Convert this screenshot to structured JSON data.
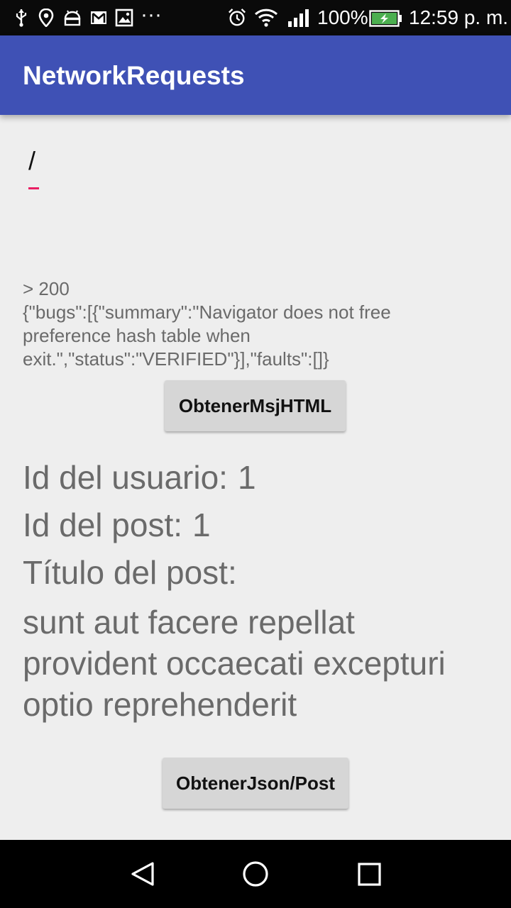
{
  "status_bar": {
    "battery_percent": "100%",
    "time": "12:59 p. m."
  },
  "app_bar": {
    "title": "NetworkRequests"
  },
  "url_input": {
    "value": "/"
  },
  "response": {
    "status_line": "> 200",
    "body_lines": [
      "{\"bugs\":[{\"summary\":\"Navigator does not free",
      "preference hash table when",
      "exit.\",\"status\":\"VERIFIED\"}],\"faults\":[]}"
    ]
  },
  "buttons": {
    "get_html": "ObtenerMsjHTML",
    "get_json": "ObtenerJson/Post"
  },
  "post": {
    "user_id_label": "Id del usuario:",
    "user_id_value": "1",
    "post_id_label": "Id del post:",
    "post_id_value": "1",
    "title_label": "Título del post:",
    "title_lines": [
      "sunt aut facere repellat",
      "provident occaecati excepturi",
      "optio reprehenderit"
    ]
  },
  "colors": {
    "app_bar": "#3f51b5",
    "accent": "#e91e63",
    "background": "#eeeeee",
    "battery": "#4caf50"
  }
}
